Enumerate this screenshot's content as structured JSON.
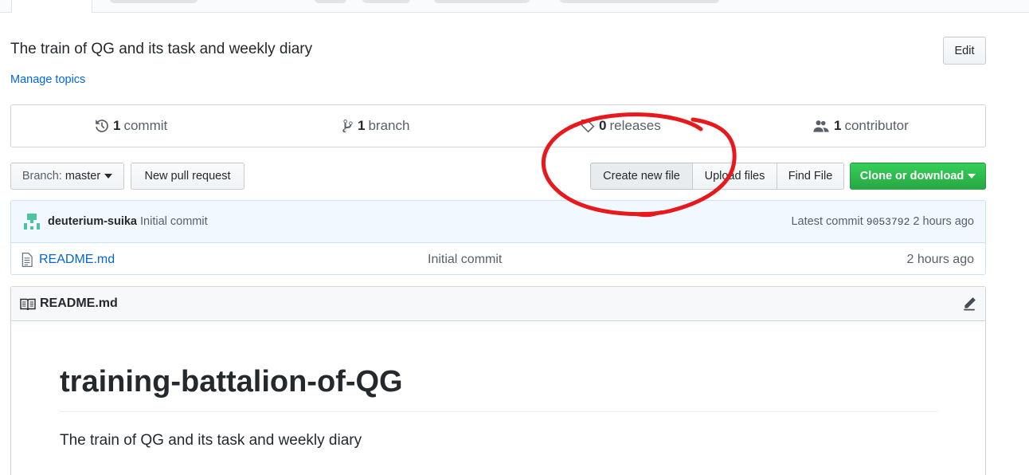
{
  "repo": {
    "description": "The train of QG and its task and weekly diary",
    "manage_topics": "Manage topics",
    "edit_label": "Edit"
  },
  "numbers": {
    "commits": {
      "count": "1",
      "label": "commit",
      "icon": "history-icon"
    },
    "branches": {
      "count": "1",
      "label": "branch",
      "icon": "branch-icon"
    },
    "releases": {
      "count": "0",
      "label": "releases",
      "icon": "tag-icon"
    },
    "contributors": {
      "count": "1",
      "label": "contributor",
      "icon": "people-icon"
    }
  },
  "toolbar": {
    "branch_prefix": "Branch:",
    "branch_name": "master",
    "new_pull_request": "New pull request",
    "create_new_file": "Create new file",
    "upload_files": "Upload files",
    "find_file": "Find File",
    "clone_or_download": "Clone or download"
  },
  "latest_commit": {
    "author": "deuterium-suika",
    "message": "Initial commit",
    "prefix": "Latest commit",
    "sha": "9053792",
    "age": "2 hours ago"
  },
  "files": [
    {
      "name": "README.md",
      "message": "Initial commit",
      "age": "2 hours ago",
      "icon": "file-icon"
    }
  ],
  "readme": {
    "header": "README.md",
    "heading": "training-battalion-of-QG",
    "body": "The train of QG and its task and weekly diary"
  },
  "colors": {
    "link": "#0366d6",
    "clone_button": "#28a745",
    "commit_bar": "#f1f8ff",
    "annotation": "#e8191c"
  }
}
